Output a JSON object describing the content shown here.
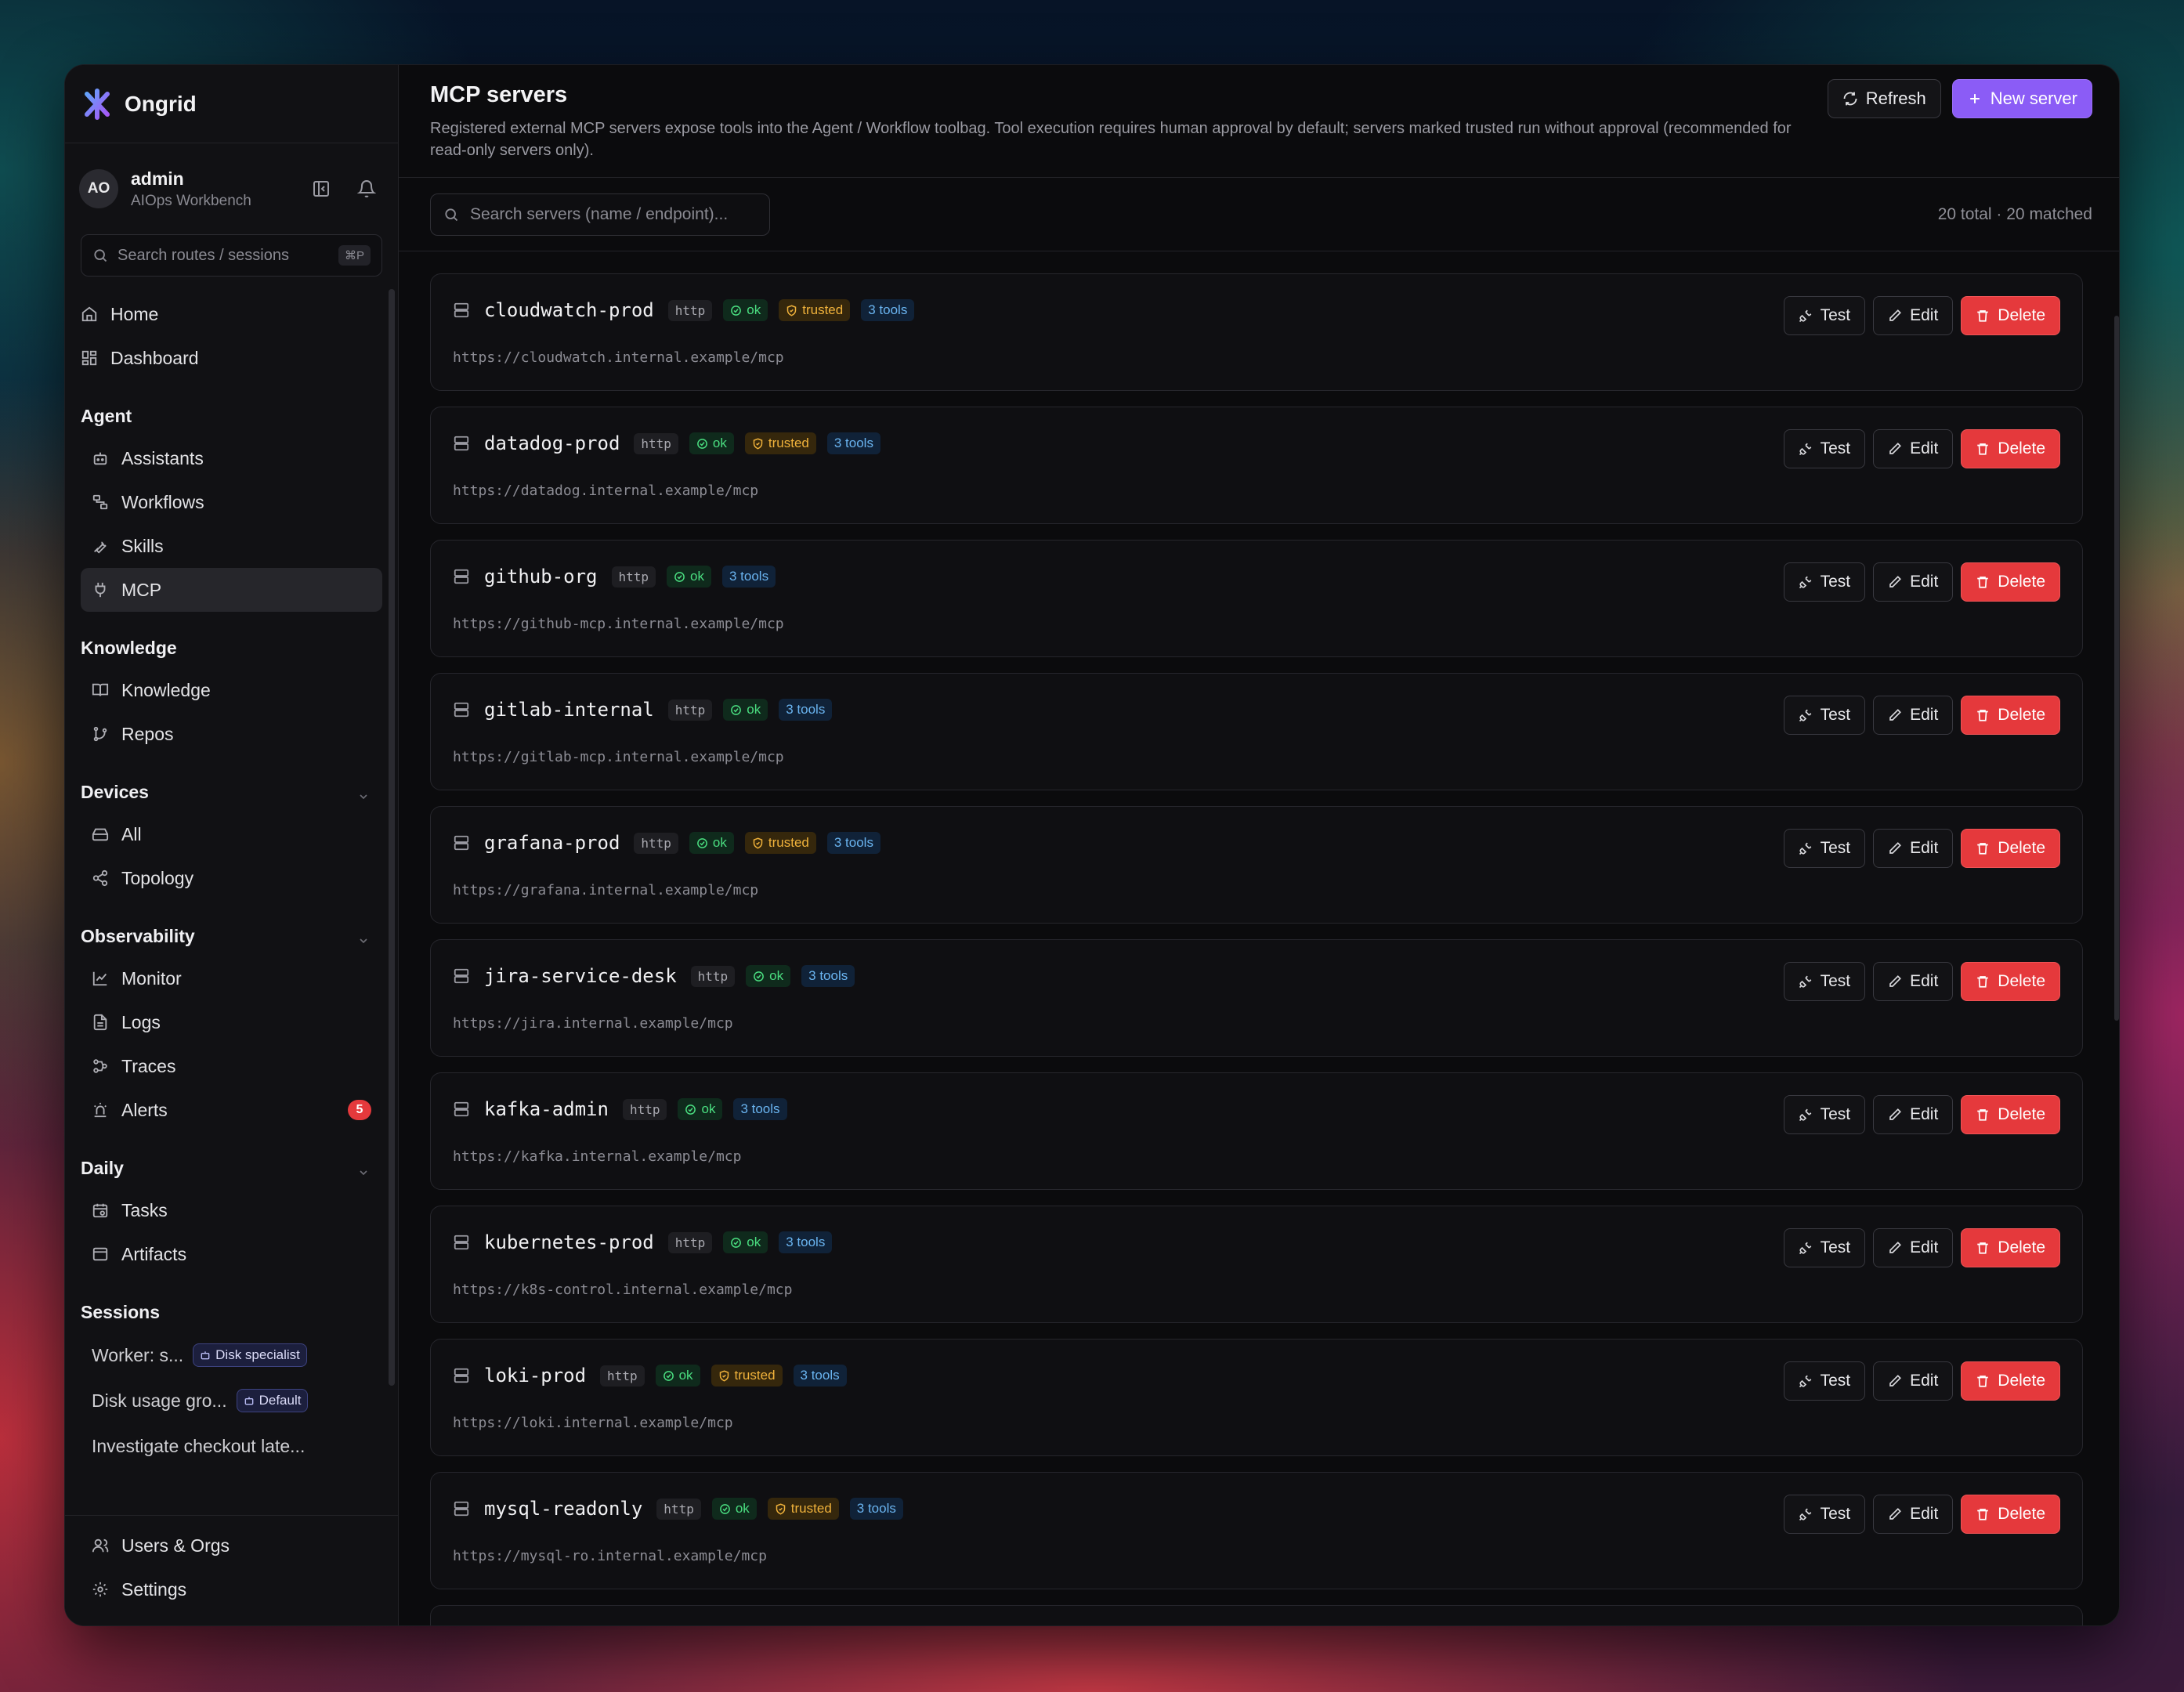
{
  "app": {
    "name": "Ongrid"
  },
  "user": {
    "initials": "AO",
    "name": "admin",
    "subtitle": "AIOps Workbench"
  },
  "sidebar_search": {
    "placeholder": "Search routes / sessions",
    "shortcut": "⌘P"
  },
  "nav": {
    "home": "Home",
    "dashboard": "Dashboard",
    "agent": {
      "title": "Agent",
      "items": [
        "Assistants",
        "Workflows",
        "Skills",
        "MCP"
      ]
    },
    "knowledge": {
      "title": "Knowledge",
      "items": [
        "Knowledge",
        "Repos"
      ]
    },
    "devices": {
      "title": "Devices",
      "items": [
        "All",
        "Topology"
      ]
    },
    "observability": {
      "title": "Observability",
      "items": [
        "Monitor",
        "Logs",
        "Traces",
        "Alerts"
      ],
      "alerts_count": "5"
    },
    "daily": {
      "title": "Daily",
      "items": [
        "Tasks",
        "Artifacts"
      ]
    },
    "sessions": {
      "title": "Sessions",
      "items": [
        {
          "label": "Worker: s...",
          "chip": "Disk specialist"
        },
        {
          "label": "Disk usage gro...",
          "chip": "Default"
        },
        {
          "label": "Investigate checkout late...",
          "chip": ""
        }
      ]
    },
    "bottom": [
      "Users & Orgs",
      "Settings"
    ]
  },
  "page": {
    "title": "MCP servers",
    "description": "Registered external MCP servers expose tools into the Agent / Workflow toolbag. Tool execution requires human approval by default; servers marked trusted run without approval (recommended for read-only servers only).",
    "refresh_label": "Refresh",
    "new_label": "New server",
    "search_placeholder": "Search servers (name / endpoint)...",
    "count": "20 total · 20 matched"
  },
  "labels": {
    "test": "Test",
    "edit": "Edit",
    "delete": "Delete"
  },
  "servers": [
    {
      "name": "cloudwatch-prod",
      "proto": "http",
      "status": "ok",
      "trusted": "trusted",
      "tools": "3 tools",
      "endpoint": "https://cloudwatch.internal.example/mcp"
    },
    {
      "name": "datadog-prod",
      "proto": "http",
      "status": "ok",
      "trusted": "trusted",
      "tools": "3 tools",
      "endpoint": "https://datadog.internal.example/mcp"
    },
    {
      "name": "github-org",
      "proto": "http",
      "status": "ok",
      "trusted": "",
      "tools": "3 tools",
      "endpoint": "https://github-mcp.internal.example/mcp"
    },
    {
      "name": "gitlab-internal",
      "proto": "http",
      "status": "ok",
      "trusted": "",
      "tools": "3 tools",
      "endpoint": "https://gitlab-mcp.internal.example/mcp"
    },
    {
      "name": "grafana-prod",
      "proto": "http",
      "status": "ok",
      "trusted": "trusted",
      "tools": "3 tools",
      "endpoint": "https://grafana.internal.example/mcp"
    },
    {
      "name": "jira-service-desk",
      "proto": "http",
      "status": "ok",
      "trusted": "",
      "tools": "3 tools",
      "endpoint": "https://jira.internal.example/mcp"
    },
    {
      "name": "kafka-admin",
      "proto": "http",
      "status": "ok",
      "trusted": "",
      "tools": "3 tools",
      "endpoint": "https://kafka.internal.example/mcp"
    },
    {
      "name": "kubernetes-prod",
      "proto": "http",
      "status": "ok",
      "trusted": "",
      "tools": "3 tools",
      "endpoint": "https://k8s-control.internal.example/mcp"
    },
    {
      "name": "loki-prod",
      "proto": "http",
      "status": "ok",
      "trusted": "trusted",
      "tools": "3 tools",
      "endpoint": "https://loki.internal.example/mcp"
    },
    {
      "name": "mysql-readonly",
      "proto": "http",
      "status": "ok",
      "trusted": "trusted",
      "tools": "3 tools",
      "endpoint": "https://mysql-ro.internal.example/mcp"
    }
  ],
  "colors": {
    "accent": "#8b5cf6",
    "danger": "#e5393c",
    "ok": "#4ade80",
    "trusted": "#f0b23b",
    "tools": "#6ab4f0"
  }
}
